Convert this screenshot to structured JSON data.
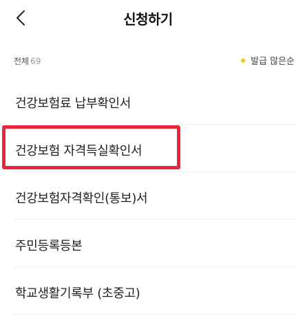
{
  "header": {
    "back_icon": "chevron-left-icon",
    "title": "신청하기"
  },
  "filter": {
    "total_label": "전체",
    "total_count": "69",
    "sort_label": "발급 많은순",
    "sort_dot_color": "#f5c800"
  },
  "items": [
    {
      "label": "건강보험료 납부확인서"
    },
    {
      "label": "건강보험 자격득실확인서"
    },
    {
      "label": "건강보험자격확인(통보)서"
    },
    {
      "label": "주민등록등본"
    },
    {
      "label": "학교생활기록부 (초중고)"
    }
  ],
  "highlight_color": "#e8273a"
}
